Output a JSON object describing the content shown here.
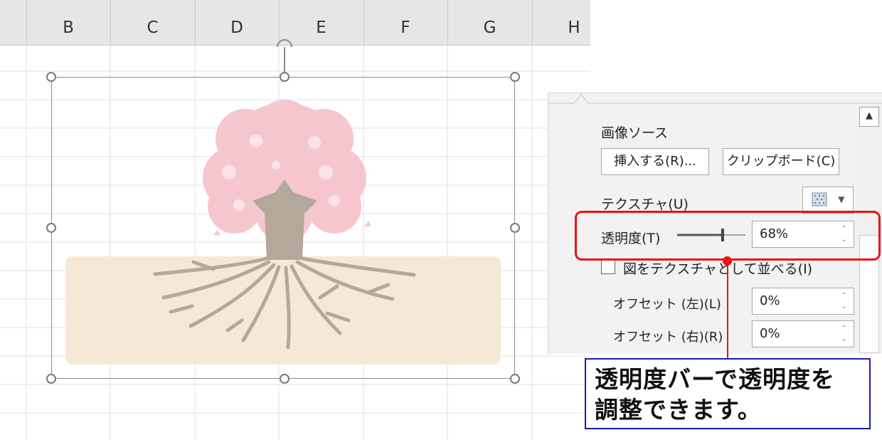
{
  "spreadsheet": {
    "columns": [
      "B",
      "C",
      "D",
      "E",
      "F",
      "G",
      "H"
    ]
  },
  "format_pane": {
    "image_source_label": "画像ソース",
    "insert_button": "挿入する(R)...",
    "clipboard_button": "クリップボード(C)",
    "texture_label": "テクスチャ(U)",
    "transparency_label": "透明度(T)",
    "transparency_value": "68%",
    "transparency_level_percent": 68,
    "tile_checkbox_label": "図をテクスチャとして並べる(I)",
    "tile_checked": false,
    "offset_left_label": "オフセット (左)(L)",
    "offset_left_value": "0%",
    "offset_right_label": "オフセット (右)(R)",
    "offset_right_value": "0%"
  },
  "callout": {
    "line1": "透明度バーで透明度を",
    "line2": "調整できます。"
  },
  "colors": {
    "highlight": "#ee1111",
    "callout_border": "#1a1aa8",
    "blossom": "#f4c2cb",
    "trunk": "#b5a89a",
    "soil": "#f6e8d6"
  }
}
